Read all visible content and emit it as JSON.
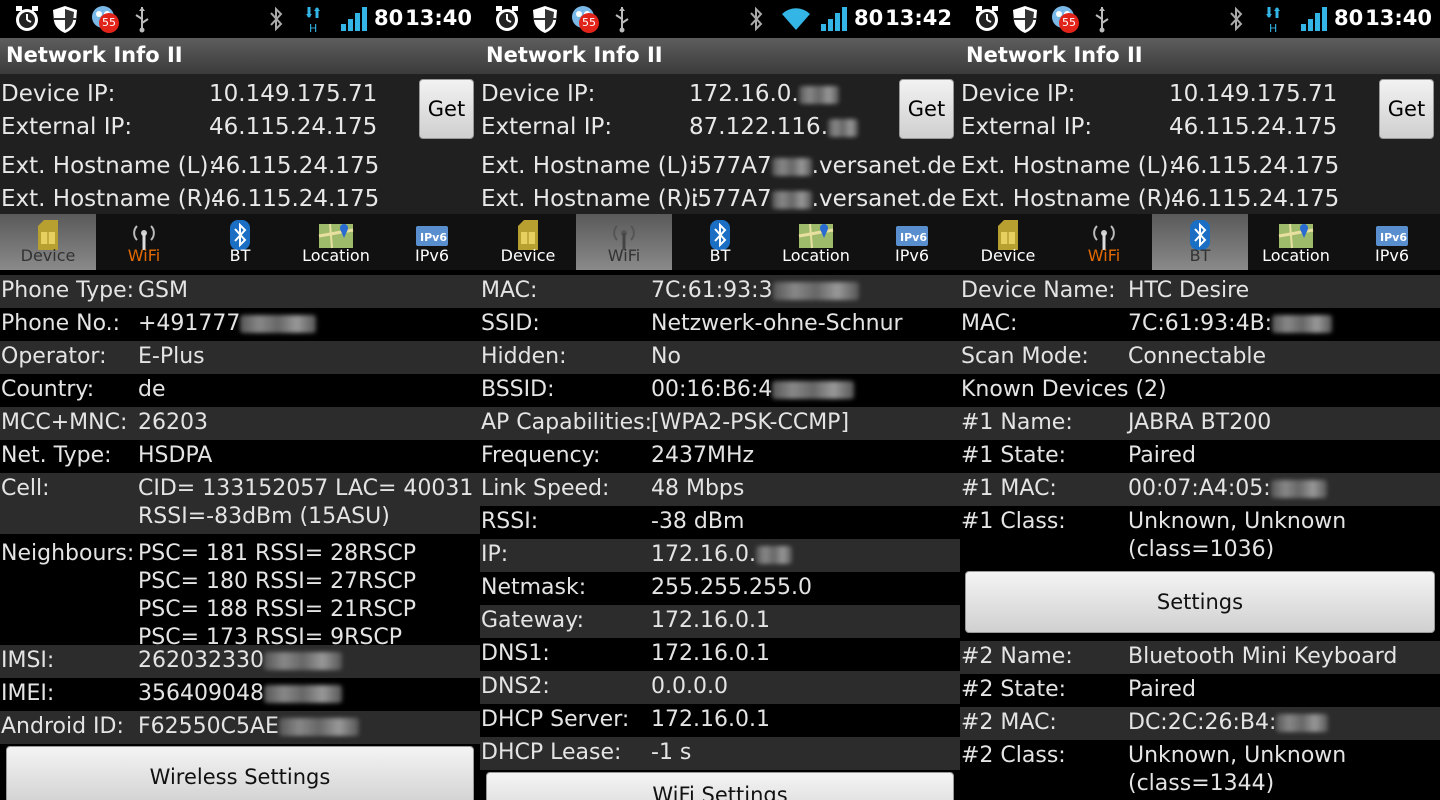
{
  "app_title": "Network Info II",
  "get_label": "Get",
  "labels": {
    "device_ip": "Device IP:",
    "external_ip": "External IP:",
    "ext_hostname_l": "Ext. Hostname (L):",
    "ext_hostname_r": "Ext. Hostname (R):"
  },
  "tabs": [
    "Device",
    "WiFi",
    "BT",
    "Location",
    "IPv6"
  ],
  "colors": {
    "accent_orange": "#e26a00",
    "battery_green": "#33b5e5",
    "notif_red": "#e2231a"
  },
  "panels": [
    {
      "status": {
        "battery": "80",
        "time": "13:40",
        "notif_count": "55"
      },
      "header": {
        "device_ip": "10.149.175.71",
        "external_ip": "46.115.24.175",
        "ext_hostname_l": "46.115.24.175",
        "ext_hostname_r": "46.115.24.175"
      },
      "active_tab": "Device",
      "rows": [
        {
          "label": "Phone Type:",
          "value": "GSM"
        },
        {
          "label": "Phone No.:",
          "value": "+491777"
        },
        {
          "label": "Operator:",
          "value": "E-Plus"
        },
        {
          "label": "Country:",
          "value": "de"
        },
        {
          "label": "MCC+MNC:",
          "value": "26203"
        },
        {
          "label": "Net. Type:",
          "value": "HSDPA"
        },
        {
          "label": "Cell:",
          "value": "CID= 133152057 LAC= 40031",
          "value2": "RSSI=-83dBm (15ASU)"
        },
        {
          "label": "Neighbours:",
          "value": "PSC= 181 RSSI= 28RSCP",
          "value2": "PSC= 180 RSSI= 27RSCP",
          "value3": "PSC= 188 RSSI= 21RSCP",
          "value4": "PSC= 173 RSSI= 9RSCP"
        },
        {
          "label": "IMSI:",
          "value": "262032330"
        },
        {
          "label": "IMEI:",
          "value": "356409048"
        },
        {
          "label": "Android ID:",
          "value": "F62550C5AE"
        }
      ],
      "button": "Wireless Settings"
    },
    {
      "status": {
        "battery": "80",
        "time": "13:42",
        "notif_count": "55"
      },
      "header": {
        "device_ip": "172.16.0.",
        "external_ip": "87.122.116.",
        "ext_hostname_l": "i577A7",
        "ext_hostname_l_suffix": ".versanet.de",
        "ext_hostname_r": "i577A7",
        "ext_hostname_r_suffix": ".versanet.de"
      },
      "active_tab": "WiFi",
      "rows": [
        {
          "label": "MAC:",
          "value": "7C:61:93:3"
        },
        {
          "label": "SSID:",
          "value": "Netzwerk-ohne-Schnur"
        },
        {
          "label": "Hidden:",
          "value": "No"
        },
        {
          "label": "BSSID:",
          "value": "00:16:B6:4"
        },
        {
          "label": "AP Capabilities:",
          "value": "[WPA2-PSK-CCMP]"
        },
        {
          "label": "Frequency:",
          "value": "2437MHz"
        },
        {
          "label": "Link Speed:",
          "value": "48 Mbps"
        },
        {
          "label": "RSSI:",
          "value": "-38 dBm"
        },
        {
          "label": "IP:",
          "value": "172.16.0."
        },
        {
          "label": "Netmask:",
          "value": "255.255.255.0"
        },
        {
          "label": "Gateway:",
          "value": "172.16.0.1"
        },
        {
          "label": "DNS1:",
          "value": "172.16.0.1"
        },
        {
          "label": "DNS2:",
          "value": "0.0.0.0"
        },
        {
          "label": "DHCP Server:",
          "value": "172.16.0.1"
        },
        {
          "label": "DHCP Lease:",
          "value": "-1 s"
        }
      ],
      "button": "WiFi Settings"
    },
    {
      "status": {
        "battery": "80",
        "time": "13:40",
        "notif_count": "55"
      },
      "header": {
        "device_ip": "10.149.175.71",
        "external_ip": "46.115.24.175",
        "ext_hostname_l": "46.115.24.175",
        "ext_hostname_r": "46.115.24.175"
      },
      "active_tab": "BT",
      "rows": [
        {
          "label": "Device Name:",
          "value": "HTC Desire"
        },
        {
          "label": "MAC:",
          "value": "7C:61:93:4B:"
        },
        {
          "label": "Scan Mode:",
          "value": "Connectable"
        },
        {
          "label": "Known Devices (2)",
          "value": ""
        },
        {
          "label": "#1 Name:",
          "value": "JABRA BT200"
        },
        {
          "label": "#1 State:",
          "value": "Paired"
        },
        {
          "label": "#1 MAC:",
          "value": "00:07:A4:05:"
        },
        {
          "label": "#1 Class:",
          "value": "Unknown, Unknown",
          "value2": "(class=1036)"
        }
      ],
      "button": "Settings",
      "rows2": [
        {
          "label": "#2 Name:",
          "value": "Bluetooth Mini Keyboard"
        },
        {
          "label": "#2 State:",
          "value": "Paired"
        },
        {
          "label": "#2 MAC:",
          "value": "DC:2C:26:B4:"
        },
        {
          "label": "#2 Class:",
          "value": "Unknown, Unknown",
          "value2": "(class=1344)"
        }
      ]
    }
  ]
}
